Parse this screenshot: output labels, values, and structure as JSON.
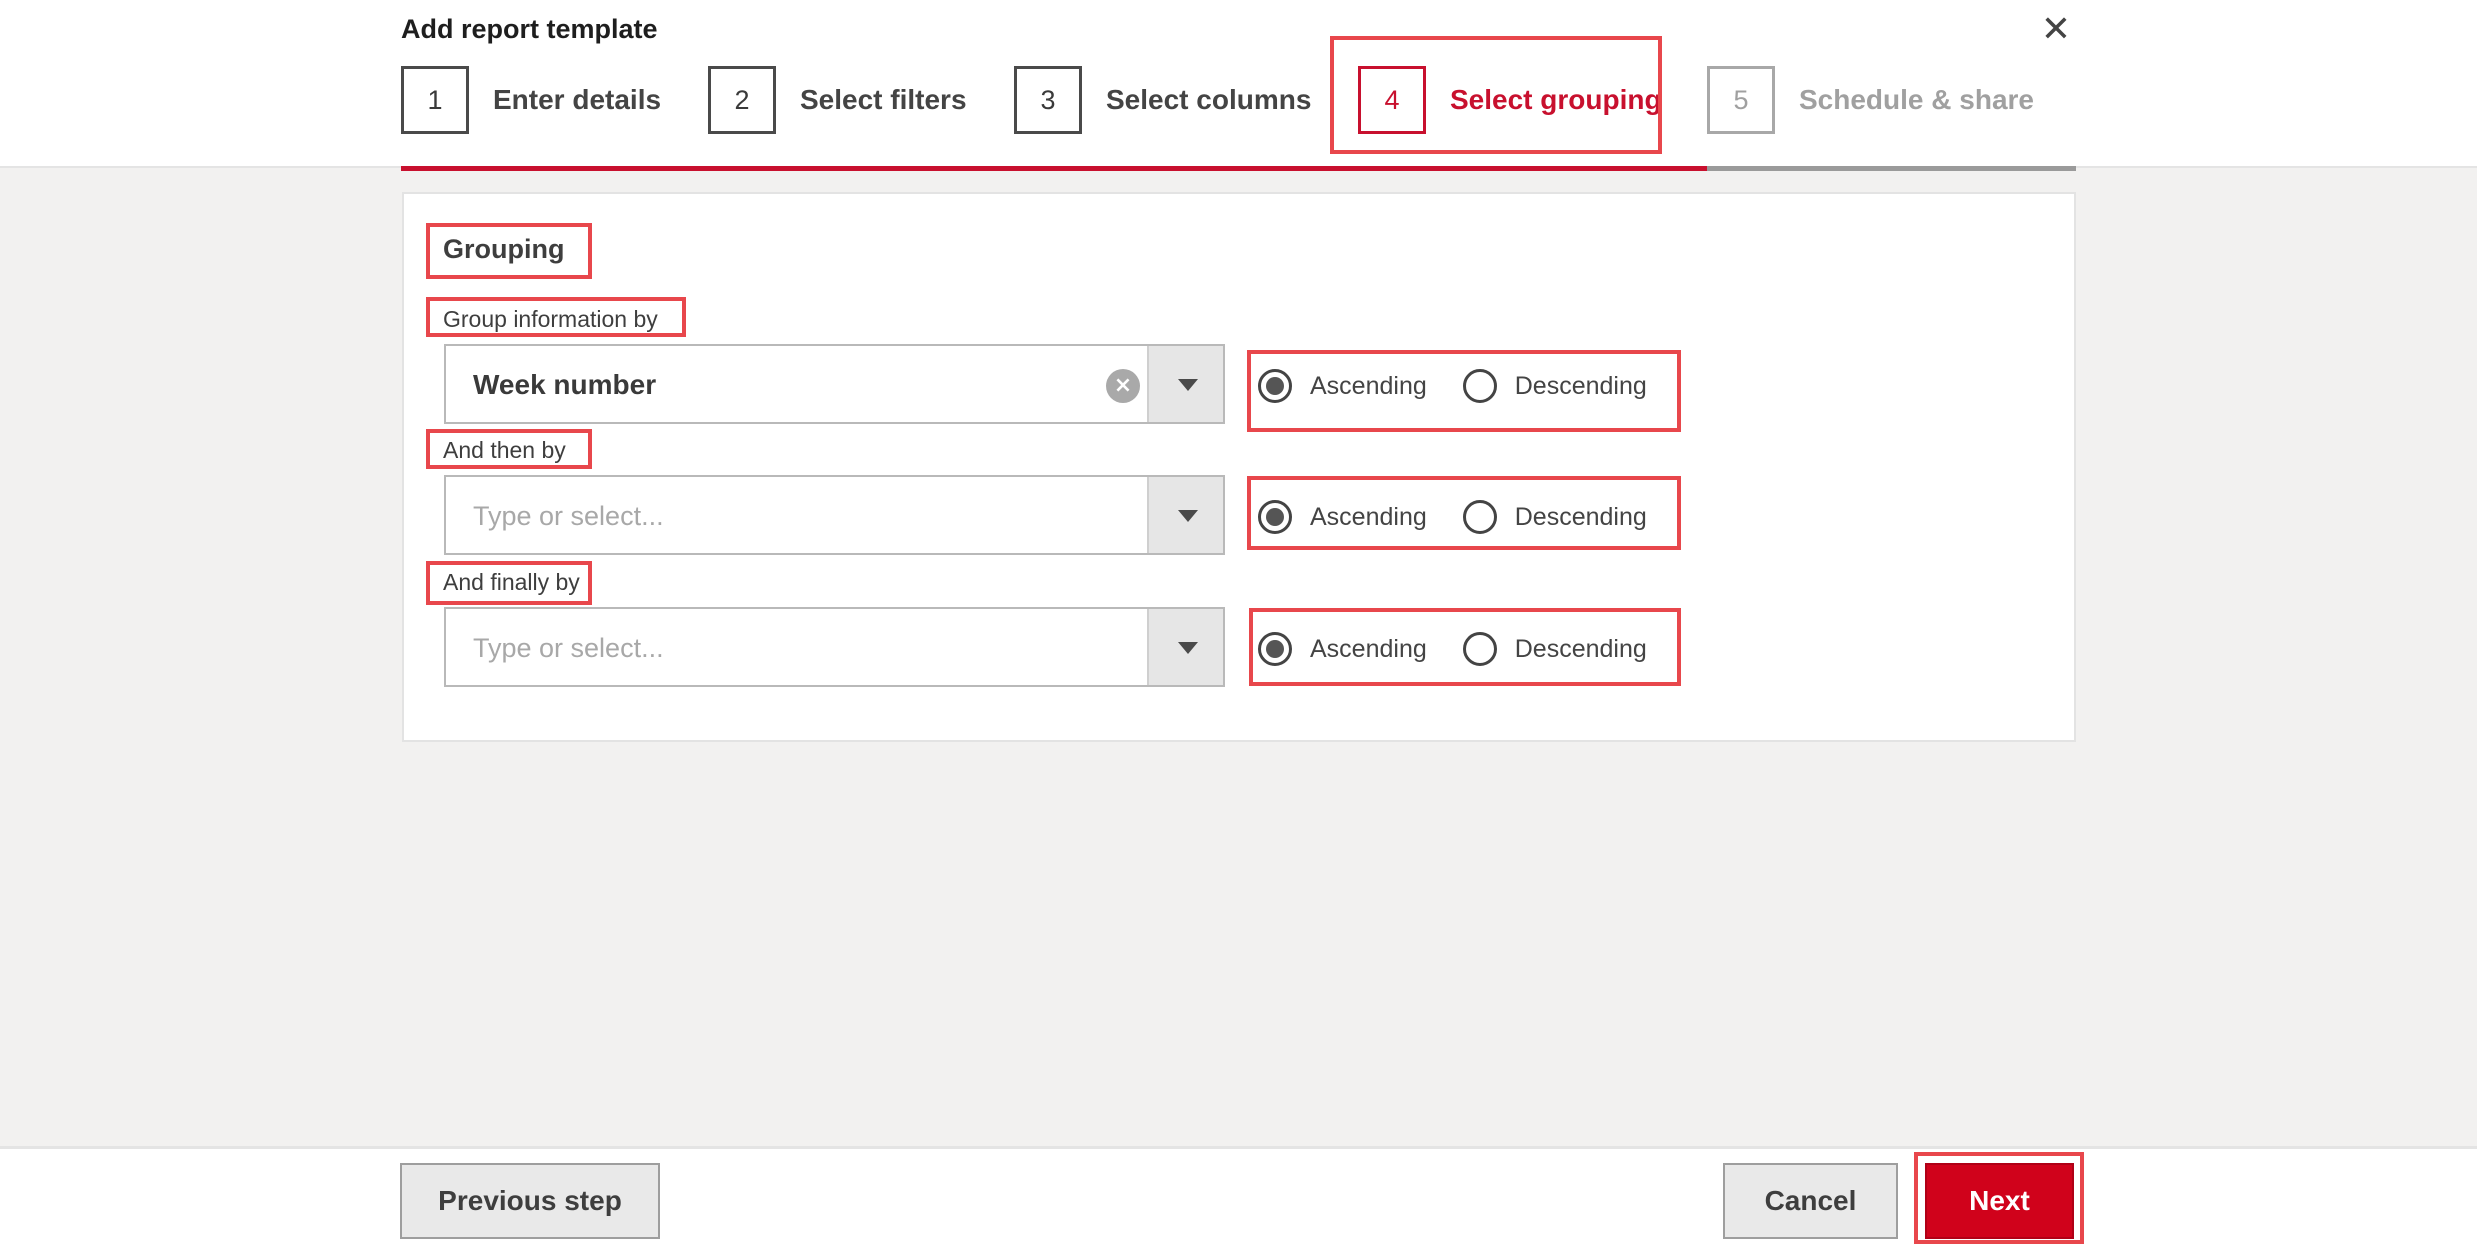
{
  "dialog": {
    "title": "Add report template",
    "close_icon": "✕"
  },
  "steps": [
    {
      "number": "1",
      "label": "Enter details",
      "state": "done"
    },
    {
      "number": "2",
      "label": "Select filters",
      "state": "done"
    },
    {
      "number": "3",
      "label": "Select columns",
      "state": "done"
    },
    {
      "number": "4",
      "label": "Select grouping",
      "state": "active"
    },
    {
      "number": "5",
      "label": "Schedule & share",
      "state": "future"
    }
  ],
  "grouping": {
    "title": "Grouping",
    "rows": [
      {
        "label": "Group information by",
        "value": "Week number",
        "placeholder": "",
        "order": "Ascending"
      },
      {
        "label": "And then by",
        "value": "",
        "placeholder": "Type or select...",
        "order": "Ascending"
      },
      {
        "label": "And finally by",
        "value": "",
        "placeholder": "Type or select...",
        "order": "Ascending"
      }
    ],
    "ascending_label": "Ascending",
    "descending_label": "Descending",
    "clear_icon": "×"
  },
  "footer": {
    "previous_label": "Previous step",
    "cancel_label": "Cancel",
    "next_label": "Next"
  },
  "colors": {
    "accent": "#c8102e",
    "highlight": "#e8474c",
    "background": "#f2f1f0"
  }
}
